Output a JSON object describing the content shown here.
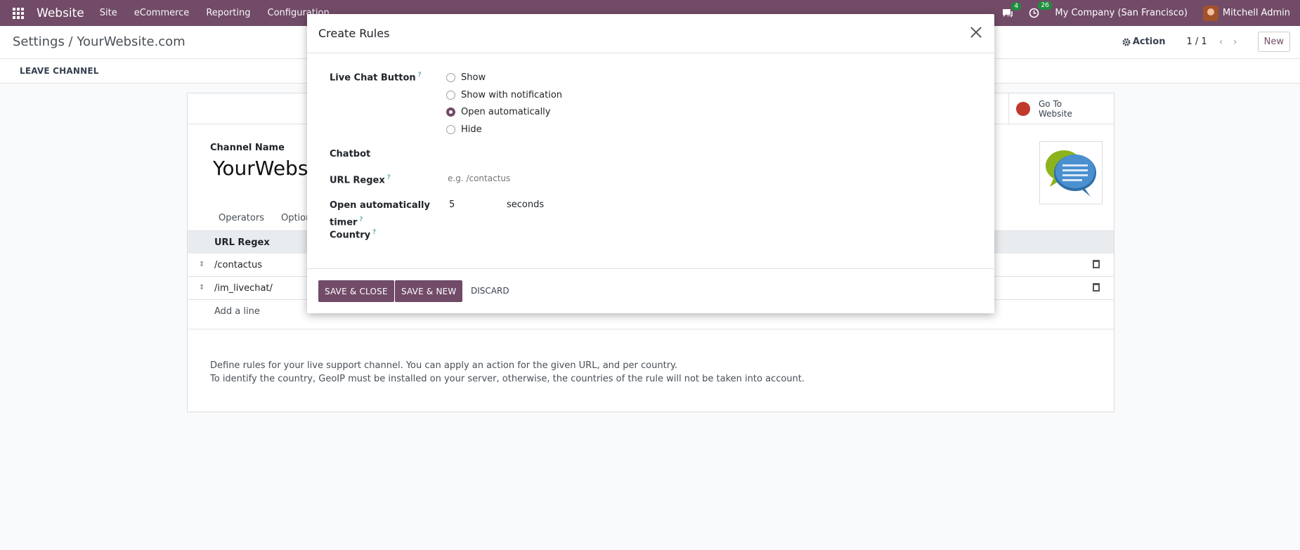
{
  "navbar": {
    "brand": "Website",
    "menu": [
      "Site",
      "eCommerce",
      "Reporting",
      "Configuration"
    ],
    "messages_count": "4",
    "activities_count": "26",
    "company": "My Company (San Francisco)",
    "user": "Mitchell Admin"
  },
  "control_panel": {
    "breadcrumb": "Settings / YourWebsite.com",
    "action_label": "Action",
    "pager": "1 / 1",
    "new_label": "New"
  },
  "status_bar": {
    "leave_label": "LEAVE CHANNEL"
  },
  "form": {
    "go_website_label": "Go To Website",
    "channel_name_label": "Channel Name",
    "channel_name": "YourWebsite",
    "tabs": [
      "Operators",
      "Option"
    ],
    "grid_header": "URL Regex",
    "rows": [
      "/contactus",
      "/im_livechat/"
    ],
    "add_line": "Add a line",
    "help_line_1": "Define rules for your live support channel. You can apply an action for the given URL, and per country.",
    "help_line_2": "To identify the country, GeoIP must be installed on your server, otherwise, the countries of the rule will not be taken into account."
  },
  "modal": {
    "title": "Create Rules",
    "live_chat_label": "Live Chat Button",
    "help_mark": "?",
    "radio_options": [
      "Show",
      "Show with notification",
      "Open automatically",
      "Hide"
    ],
    "radio_selected": "Open automatically",
    "chatbot_label": "Chatbot",
    "url_regex_label": "URL Regex",
    "url_regex_placeholder": "e.g. /contactus",
    "timer_label_1": "Open automatically",
    "timer_label_2": "timer",
    "timer_value": "5",
    "timer_unit": "seconds",
    "country_label": "Country",
    "save_close": "SAVE & CLOSE",
    "save_new": "SAVE & NEW",
    "discard": "DISCARD"
  }
}
